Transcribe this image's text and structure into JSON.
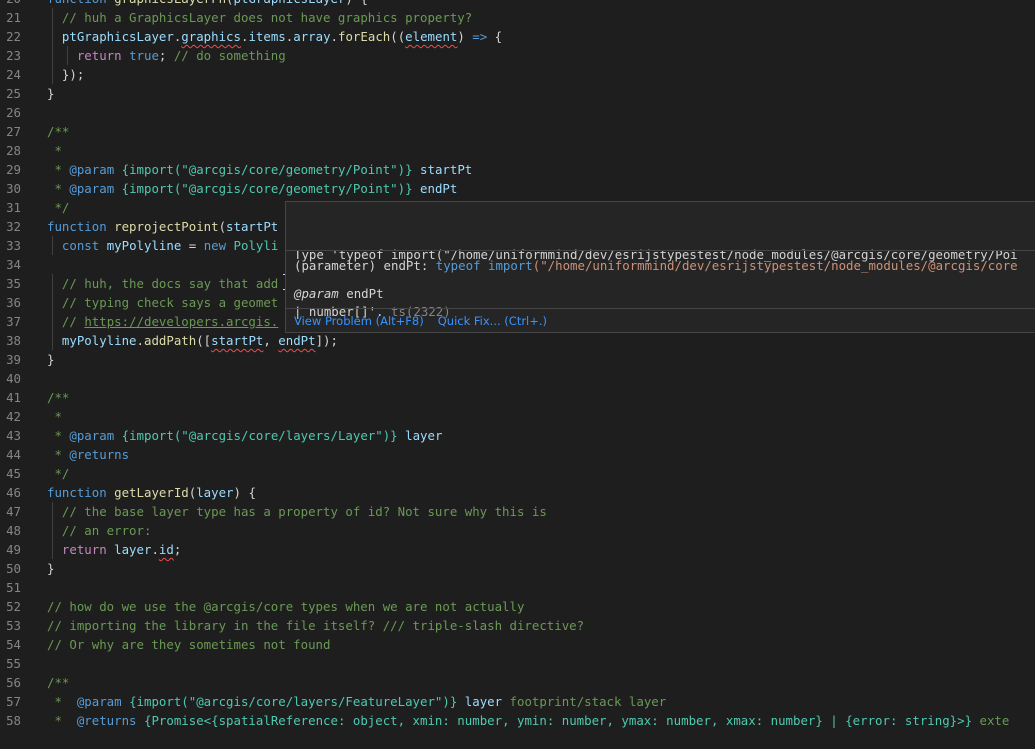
{
  "editor": {
    "lines": [
      {
        "n": "20",
        "segs": [
          [
            "kw",
            "function "
          ],
          [
            "fn",
            "graphicsLayerFn"
          ],
          [
            "",
            "("
          ],
          [
            "var",
            "ptGraphicsLayer"
          ],
          [
            "",
            ") {"
          ]
        ]
      },
      {
        "n": "21",
        "ind": 1,
        "segs": [
          [
            "com",
            "// huh a GraphicsLayer does not have graphics property?"
          ]
        ]
      },
      {
        "n": "22",
        "ind": 1,
        "segs": [
          [
            "var",
            "ptGraphicsLayer"
          ],
          [
            "",
            "."
          ],
          [
            "var sq",
            "graphics"
          ],
          [
            "",
            "."
          ],
          [
            "var",
            "items"
          ],
          [
            "",
            "."
          ],
          [
            "var",
            "array"
          ],
          [
            "",
            "."
          ],
          [
            "fn",
            "forEach"
          ],
          [
            "",
            "(("
          ],
          [
            "var sq",
            "element"
          ],
          [
            "",
            ") "
          ],
          [
            "kw",
            "=>"
          ],
          [
            "",
            " {"
          ]
        ]
      },
      {
        "n": "23",
        "ind": 2,
        "segs": [
          [
            "ctl",
            "return "
          ],
          [
            "kw",
            "true"
          ],
          [
            "",
            "; "
          ],
          [
            "com",
            "// do something"
          ]
        ]
      },
      {
        "n": "24",
        "ind": 1,
        "segs": [
          [
            "",
            "});"
          ]
        ]
      },
      {
        "n": "25",
        "segs": [
          [
            "",
            "}"
          ]
        ]
      },
      {
        "n": "26",
        "segs": []
      },
      {
        "n": "27",
        "segs": [
          [
            "com",
            "/**"
          ]
        ]
      },
      {
        "n": "28",
        "segs": [
          [
            "com",
            " *"
          ]
        ]
      },
      {
        "n": "29",
        "segs": [
          [
            "com",
            " * "
          ],
          [
            "kw",
            "@param"
          ],
          [
            "com",
            " "
          ],
          [
            "typ",
            "{import(\"@arcgis/core/geometry/Point\")}"
          ],
          [
            "com",
            " "
          ],
          [
            "var",
            "startPt"
          ]
        ]
      },
      {
        "n": "30",
        "segs": [
          [
            "com",
            " * "
          ],
          [
            "kw",
            "@param"
          ],
          [
            "com",
            " "
          ],
          [
            "typ",
            "{import(\"@arcgis/core/geometry/Point\")}"
          ],
          [
            "com",
            " "
          ],
          [
            "var",
            "endPt"
          ]
        ]
      },
      {
        "n": "31",
        "segs": [
          [
            "com",
            " */"
          ]
        ]
      },
      {
        "n": "32",
        "segs": [
          [
            "kw",
            "function "
          ],
          [
            "fn",
            "reprojectPoint"
          ],
          [
            "",
            "("
          ],
          [
            "var",
            "startPt"
          ]
        ]
      },
      {
        "n": "33",
        "ind": 1,
        "segs": [
          [
            "kw",
            "const "
          ],
          [
            "var",
            "myPolyline"
          ],
          [
            "",
            " = "
          ],
          [
            "kw",
            "new "
          ],
          [
            "typ",
            "Polyli"
          ]
        ]
      },
      {
        "n": "34",
        "segs": []
      },
      {
        "n": "35",
        "ind": 1,
        "segs": [
          [
            "com",
            "// huh, the docs say that add"
          ]
        ]
      },
      {
        "n": "36",
        "ind": 1,
        "segs": [
          [
            "com",
            "// typing check says a geomet"
          ]
        ]
      },
      {
        "n": "37",
        "ind": 1,
        "segs": [
          [
            "com",
            "// "
          ],
          [
            "com link",
            "https://developers.arcgis."
          ]
        ]
      },
      {
        "n": "38",
        "ind": 1,
        "segs": [
          [
            "var",
            "myPolyline"
          ],
          [
            "",
            "."
          ],
          [
            "fn",
            "addPath"
          ],
          [
            "",
            "(["
          ],
          [
            "var sq",
            "startPt"
          ],
          [
            "",
            ", "
          ],
          [
            "var sq",
            "endPt"
          ],
          [
            "",
            "]);"
          ]
        ]
      },
      {
        "n": "39",
        "segs": [
          [
            "",
            "}"
          ]
        ]
      },
      {
        "n": "40",
        "segs": []
      },
      {
        "n": "41",
        "segs": [
          [
            "com",
            "/**"
          ]
        ]
      },
      {
        "n": "42",
        "segs": [
          [
            "com",
            " *"
          ]
        ]
      },
      {
        "n": "43",
        "segs": [
          [
            "com",
            " * "
          ],
          [
            "kw",
            "@param"
          ],
          [
            "com",
            " "
          ],
          [
            "typ",
            "{import(\"@arcgis/core/layers/Layer\")}"
          ],
          [
            "com",
            " "
          ],
          [
            "var",
            "layer"
          ]
        ]
      },
      {
        "n": "44",
        "segs": [
          [
            "com",
            " * "
          ],
          [
            "kw",
            "@returns"
          ]
        ]
      },
      {
        "n": "45",
        "segs": [
          [
            "com",
            " */"
          ]
        ]
      },
      {
        "n": "46",
        "segs": [
          [
            "kw",
            "function "
          ],
          [
            "fn",
            "getLayerId"
          ],
          [
            "",
            "("
          ],
          [
            "var",
            "layer"
          ],
          [
            "",
            ") {"
          ]
        ]
      },
      {
        "n": "47",
        "ind": 1,
        "segs": [
          [
            "com",
            "// the base layer type has a property of id? Not sure why this is"
          ]
        ]
      },
      {
        "n": "48",
        "ind": 1,
        "segs": [
          [
            "com",
            "// an error:"
          ]
        ]
      },
      {
        "n": "49",
        "ind": 1,
        "segs": [
          [
            "ctl",
            "return "
          ],
          [
            "var",
            "layer"
          ],
          [
            "",
            "."
          ],
          [
            "var sq",
            "id"
          ],
          [
            "",
            ";"
          ]
        ]
      },
      {
        "n": "50",
        "segs": [
          [
            "",
            "}"
          ]
        ]
      },
      {
        "n": "51",
        "segs": []
      },
      {
        "n": "52",
        "segs": [
          [
            "com",
            "// how do we use the @arcgis/core types when we are not actually"
          ]
        ]
      },
      {
        "n": "53",
        "segs": [
          [
            "com",
            "// importing the library in the file itself? /// triple-slash directive?"
          ]
        ]
      },
      {
        "n": "54",
        "segs": [
          [
            "com",
            "// Or why are they sometimes not found"
          ]
        ]
      },
      {
        "n": "55",
        "segs": []
      },
      {
        "n": "56",
        "segs": [
          [
            "com",
            "/**"
          ]
        ]
      },
      {
        "n": "57",
        "segs": [
          [
            "com",
            " *  "
          ],
          [
            "kw",
            "@param"
          ],
          [
            "com",
            " "
          ],
          [
            "typ",
            "{import(\"@arcgis/core/layers/FeatureLayer\")}"
          ],
          [
            "com",
            " "
          ],
          [
            "var",
            "layer"
          ],
          [
            "com",
            " footprint/stack layer"
          ]
        ]
      },
      {
        "n": "58",
        "segs": [
          [
            "com",
            " *  "
          ],
          [
            "kw",
            "@returns"
          ],
          [
            "com",
            " "
          ],
          [
            "typ",
            "{Promise<{spatialReference: object, xmin: number, ymin: number, ymax: number, xmax: number} | {error: string}>}"
          ],
          [
            "com",
            " exte"
          ]
        ]
      }
    ]
  },
  "hover": {
    "error_line1": "Type 'typeof import(\"/home/uniformmind/dev/esrijstypestest/node_modules/@arcgis/core/geometry/Poi",
    "error_line2_a": "| number[]'. ",
    "error_code": "ts(2322)",
    "sig_kind": "(parameter) ",
    "sig_name": "endPt",
    "sig_colon": ": ",
    "sig_typeof": "typeof ",
    "sig_import": "import",
    "sig_path": "(\"/home/uniformmind/dev/esrijstypestest/node_modules/@arcgis/core",
    "doc_tag": "@param",
    "doc_name": "endPt",
    "view_problem": "View Problem (Alt+F8)",
    "quick_fix": "Quick Fix... (Ctrl+.)"
  }
}
